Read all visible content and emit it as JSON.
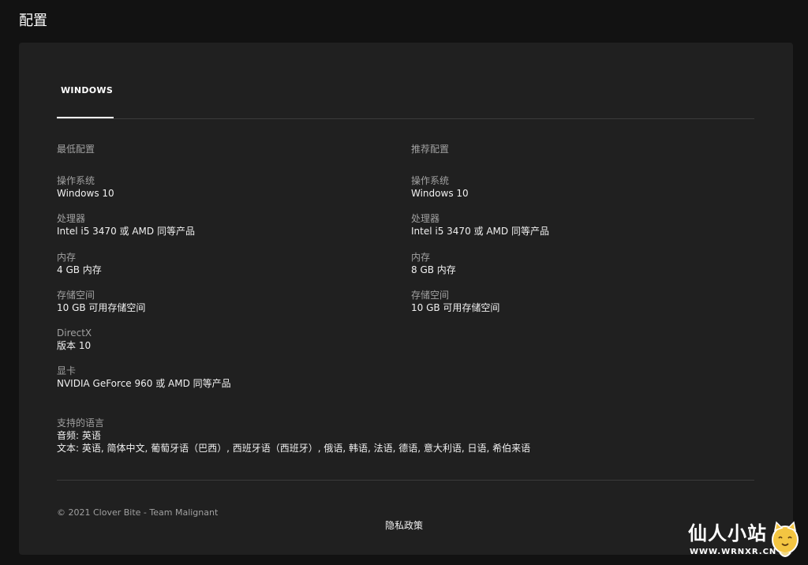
{
  "page": {
    "title": "配置"
  },
  "tabs": [
    {
      "label": "WINDOWS",
      "selected": true
    }
  ],
  "minimum": {
    "heading": "最低配置",
    "specs": [
      {
        "label": "操作系统",
        "value": "Windows 10"
      },
      {
        "label": "处理器",
        "value": "Intel i5 3470 或 AMD 同等产品"
      },
      {
        "label": "内存",
        "value": "4 GB 内存"
      },
      {
        "label": "存储空间",
        "value": "10 GB 可用存储空间"
      },
      {
        "label": "DirectX",
        "value": "版本 10"
      },
      {
        "label": "显卡",
        "value": "NVIDIA GeForce 960 或 AMD 同等产品"
      }
    ]
  },
  "recommended": {
    "heading": "推荐配置",
    "specs": [
      {
        "label": "操作系统",
        "value": "Windows 10"
      },
      {
        "label": "处理器",
        "value": "Intel i5 3470 或 AMD 同等产品"
      },
      {
        "label": "内存",
        "value": "8 GB 内存"
      },
      {
        "label": "存储空间",
        "value": "10 GB 可用存储空间"
      }
    ]
  },
  "languages": {
    "label": "支持的语言",
    "audio": "音频: 英语",
    "text": "文本: 英语, 简体中文, 葡萄牙语（巴西）, 西班牙语（西班牙）, 俄语, 韩语, 法语, 德语, 意大利语, 日语, 希伯来语"
  },
  "footer": {
    "copyright": "© 2021 Clover Bite - Team Malignant",
    "privacy": "隐私政策"
  },
  "watermark": {
    "title": "仙人小站",
    "url": "WWW.WRNXR.CN",
    "mascot_icon": "cat-face-icon"
  },
  "colors": {
    "background": "#121212",
    "card": "#202020",
    "divider": "#3a3a3a",
    "muted_text": "#a0a0a0",
    "text": "#f0f0f0"
  }
}
